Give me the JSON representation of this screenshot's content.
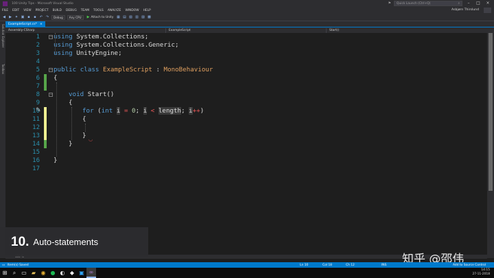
{
  "window": {
    "title": "100 Unity Tips - Microsoft Visual Studio",
    "quick_launch_placeholder": "Quick Launch (Ctrl+Q)",
    "user_name": "Asbjørn Thirslund"
  },
  "menu": [
    "FILE",
    "EDIT",
    "VIEW",
    "PROJECT",
    "BUILD",
    "DEBUG",
    "TEAM",
    "TOOLS",
    "ANALYZE",
    "WINDOW",
    "HELP"
  ],
  "toolbar": {
    "config": "Debug",
    "platform": "Any CPU",
    "attach": "Attach to Unity"
  },
  "side_tabs": [
    "Solution Explorer",
    "Toolbox"
  ],
  "tab": {
    "label": "ExampleScript.cs*",
    "close": "×"
  },
  "navbar": {
    "project": "Assembly-CSharp",
    "type": "ExampleScript",
    "member": "Start()"
  },
  "code_lines": [
    {
      "n": "1"
    },
    {
      "n": "2"
    },
    {
      "n": "3"
    },
    {
      "n": "4"
    },
    {
      "n": "5"
    },
    {
      "n": "6"
    },
    {
      "n": "7"
    },
    {
      "n": "8"
    },
    {
      "n": "9"
    },
    {
      "n": "10"
    },
    {
      "n": "11"
    },
    {
      "n": "12"
    },
    {
      "n": "13"
    },
    {
      "n": "14"
    },
    {
      "n": "15"
    },
    {
      "n": "16"
    },
    {
      "n": "17"
    }
  ],
  "code": {
    "l1_kw": "using",
    "l1_ns": "System.Collections;",
    "l2_kw": "using",
    "l2_ns": "System.Collections.Generic;",
    "l3_kw": "using",
    "l3_ns": "UnityEngine;",
    "l5_kw1": "public",
    "l5_kw2": "class",
    "l5_cls": "ExampleScript",
    "l5_colon": ":",
    "l5_base": "MonoBehaviour",
    "l6": "{",
    "l8_kw": "void",
    "l8_rest": "Start()",
    "l9": "{",
    "l10_for": "for",
    "l10_open": "(",
    "l10_int": "int",
    "l10_i1": "i",
    "l10_eq": "=",
    "l10_zero": "0",
    "l10_semi1": ";",
    "l10_i2": "i",
    "l10_lt": "<",
    "l10_len": "length",
    "l10_semi2": ";",
    "l10_i3": "i",
    "l10_pp": "++",
    "l10_close": ")",
    "l11": "{",
    "l13": "}",
    "l14": "}",
    "l16": "}"
  },
  "zoom": "100 %",
  "overlay": {
    "number": "10.",
    "title": "Auto-statements"
  },
  "watermark": "知乎 @邵伟",
  "status": {
    "saved": "Item(s) Saved",
    "ln": "Ln 10",
    "col": "Col 18",
    "ch": "Ch 12",
    "ins": "INS",
    "source_control": "Add to Source Control"
  },
  "clock": {
    "time": "14:15",
    "date": "27-11-2018"
  },
  "colors": {
    "accent": "#007acc",
    "keyword": "#569cd6",
    "type": "#4ec9b0",
    "class_name": "#e0a060",
    "line_number": "#2b91af",
    "change_saved": "#57a64a",
    "change_unsaved": "#efef91"
  }
}
